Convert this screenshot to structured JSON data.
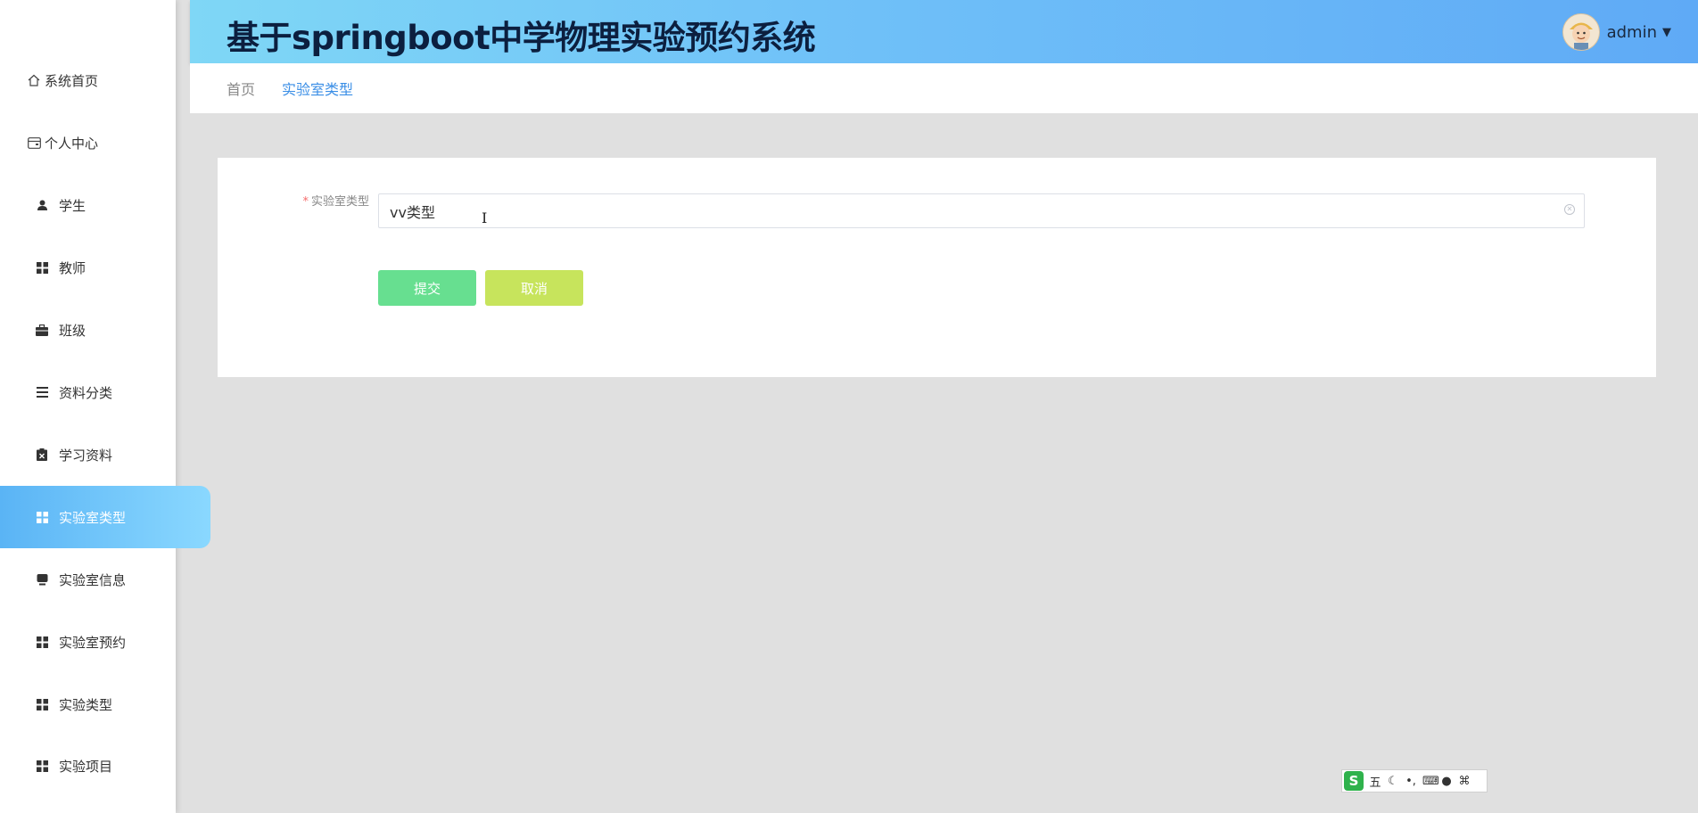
{
  "app": {
    "title": "基于springboot中学物理实验预约系统",
    "user_name": "admin"
  },
  "sidebar": {
    "items": [
      {
        "label": "系统首页",
        "icon": "home-icon"
      },
      {
        "label": "个人中心",
        "icon": "wallet-icon"
      },
      {
        "label": "学生",
        "icon": "user-icon"
      },
      {
        "label": "教师",
        "icon": "grid-icon"
      },
      {
        "label": "班级",
        "icon": "briefcase-icon"
      },
      {
        "label": "资料分类",
        "icon": "list-icon"
      },
      {
        "label": "学习资料",
        "icon": "clipboard-icon"
      },
      {
        "label": "实验室类型",
        "icon": "grid-icon",
        "active": true
      },
      {
        "label": "实验室信息",
        "icon": "monitor-icon"
      },
      {
        "label": "实验室预约",
        "icon": "grid-icon"
      },
      {
        "label": "实验类型",
        "icon": "grid-icon"
      },
      {
        "label": "实验项目",
        "icon": "grid-icon"
      }
    ]
  },
  "breadcrumb": {
    "home": "首页",
    "current": "实验室类型"
  },
  "form": {
    "required_mark": "*",
    "field_label": "实验室类型",
    "field_value": "vv类型",
    "submit_label": "提交",
    "cancel_label": "取消"
  },
  "ime": {
    "logo": "S",
    "mode": "五"
  },
  "colors": {
    "accent": "#3a8ee6",
    "submit": "#67df90",
    "cancel": "#c7e45c",
    "active_menu": "#5ab4f5"
  }
}
